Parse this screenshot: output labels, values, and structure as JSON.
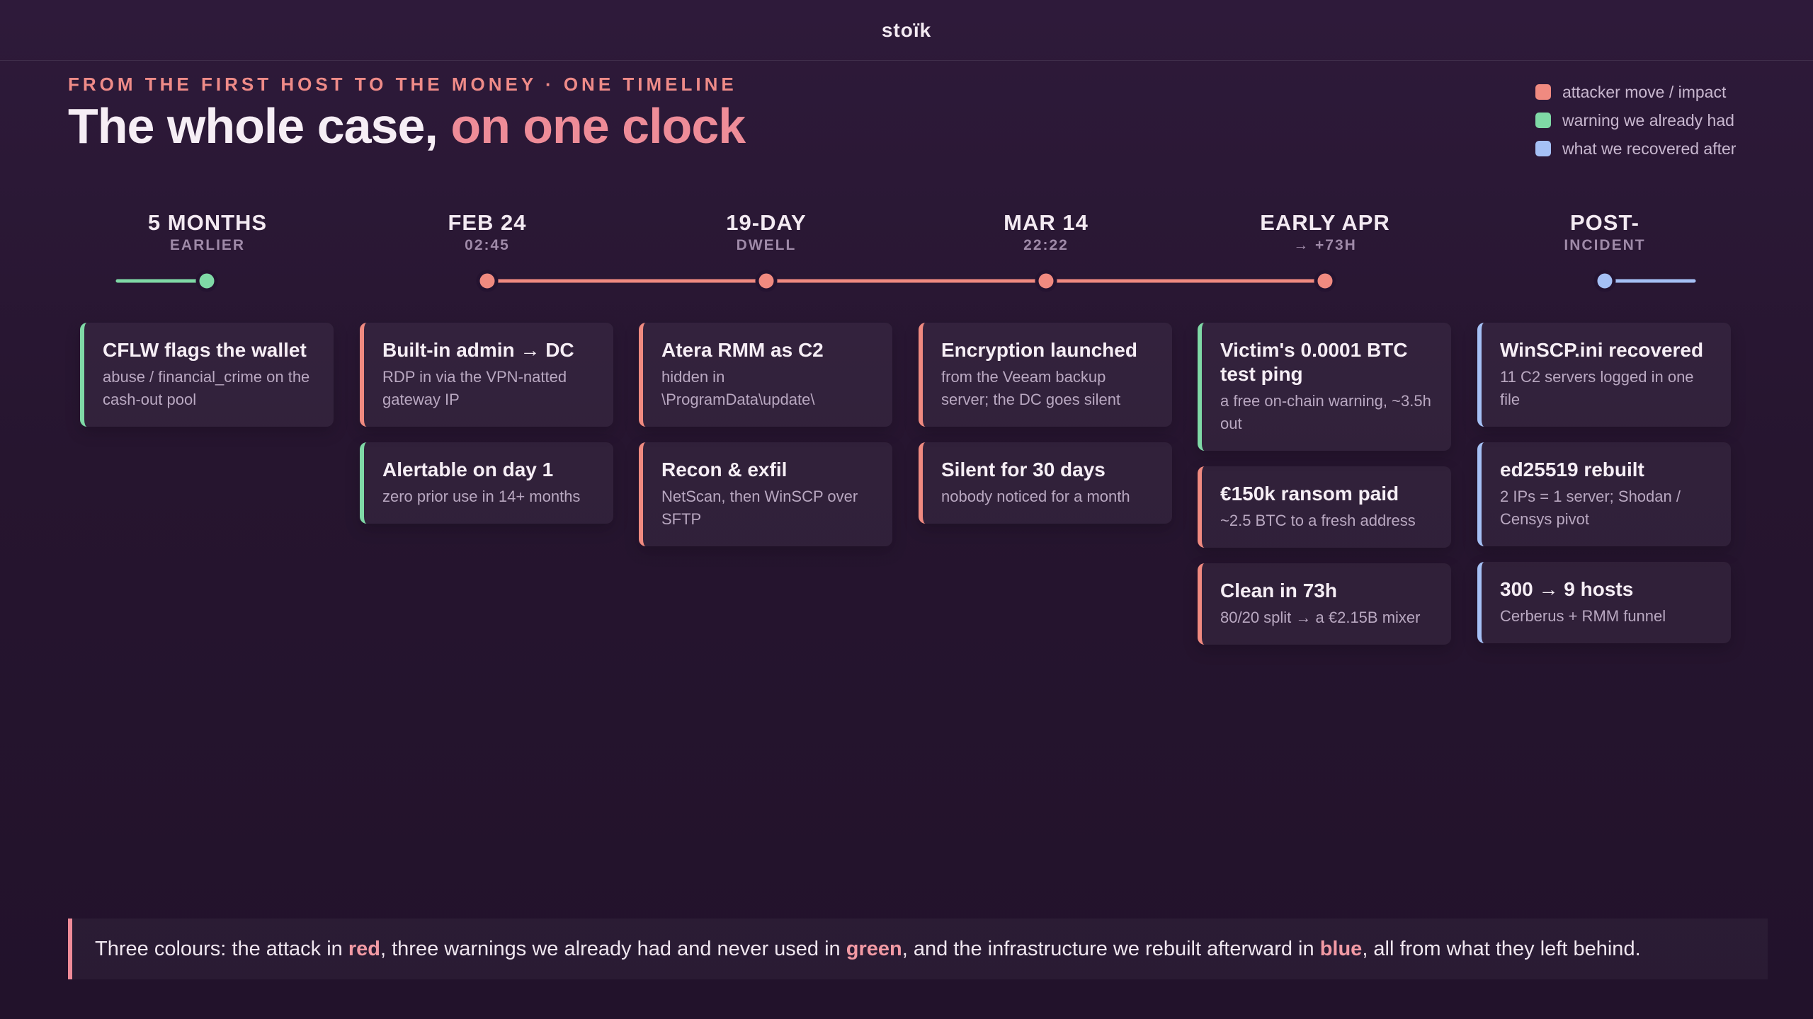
{
  "brand": "stoïk",
  "kicker": "FROM THE FIRST HOST TO THE MONEY · ONE TIMELINE",
  "title": {
    "main": "The whole case, ",
    "accent": "on one clock"
  },
  "legend": [
    {
      "label": "attacker move / impact",
      "color": "#f08a80"
    },
    {
      "label": "warning we already had",
      "color": "#7fd9a6"
    },
    {
      "label": "what we recovered after",
      "color": "#a5c0f5"
    }
  ],
  "colors": {
    "red": "#f08a80",
    "green": "#7fd9a6",
    "blue": "#a5c0f5"
  },
  "columns": [
    {
      "head": "5 MONTHS",
      "sub": "EARLIER",
      "dot": "green",
      "cards": [
        {
          "title": "CFLW flags the wallet",
          "sub": "abuse / financial_crime on the cash-out pool",
          "kind": "green"
        }
      ]
    },
    {
      "head": "FEB 24",
      "sub": "02:45",
      "dot": "red",
      "cards": [
        {
          "title": "Built-in admin → DC",
          "sub": "RDP in via the VPN-natted gateway IP",
          "kind": "red"
        },
        {
          "title": "Alertable on day 1",
          "sub": "zero prior use in 14+ months",
          "kind": "green"
        }
      ]
    },
    {
      "head": "19-DAY",
      "sub": "DWELL",
      "dot": "red",
      "cards": [
        {
          "title": "Atera RMM as C2",
          "sub": "hidden in \\ProgramData\\update\\",
          "kind": "red"
        },
        {
          "title": "Recon & exfil",
          "sub": "NetScan, then WinSCP over SFTP",
          "kind": "red"
        }
      ]
    },
    {
      "head": "MAR 14",
      "sub": "22:22",
      "dot": "red",
      "cards": [
        {
          "title": "Encryption launched",
          "sub": "from the Veeam backup server; the DC goes silent",
          "kind": "red"
        },
        {
          "title": "Silent for 30 days",
          "sub": "nobody noticed for a month",
          "kind": "red"
        }
      ]
    },
    {
      "head": "EARLY APR",
      "sub": "→ +73H",
      "dot": "red",
      "cards": [
        {
          "title": "Victim's 0.0001 BTC test ping",
          "sub": "a free on-chain warning, ~3.5h out",
          "kind": "green"
        },
        {
          "title": "€150k ransom paid",
          "sub": "~2.5 BTC to a fresh address",
          "kind": "red"
        },
        {
          "title": "Clean in 73h",
          "sub": "80/20 split → a €2.15B mixer",
          "kind": "red"
        }
      ]
    },
    {
      "head": "POST-",
      "sub": "INCIDENT",
      "dot": "blue",
      "cards": [
        {
          "title": "WinSCP.ini recovered",
          "sub": "11 C2 servers logged in one file",
          "kind": "blue"
        },
        {
          "title": "ed25519 rebuilt",
          "sub": "2 IPs = 1 server; Shodan / Censys pivot",
          "kind": "blue"
        },
        {
          "title": "300 → 9 hosts",
          "sub": "Cerberus + RMM funnel",
          "kind": "blue"
        }
      ]
    }
  ],
  "footer": {
    "p1": "Three colours: the attack in ",
    "red": "red",
    "p2": ", three warnings we already had and never used in ",
    "green": "green",
    "p3": ", and the infrastructure we rebuilt afterward in ",
    "blue": "blue",
    "p4": ", all from what they left behind."
  }
}
